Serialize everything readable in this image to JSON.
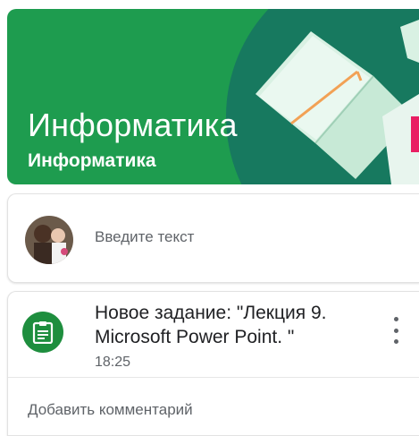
{
  "banner": {
    "title": "Информатика",
    "subtitle": "Информатика",
    "color": "#1e9c4f"
  },
  "post": {
    "placeholder": "Введите текст"
  },
  "task": {
    "title": "Новое задание: \"Лекция 9. Microsoft Power Point. \"",
    "time": "18:25",
    "icon": "assignment-icon",
    "icon_color": "#1e8e3e"
  },
  "comment": {
    "label": "Добавить комментарий"
  }
}
